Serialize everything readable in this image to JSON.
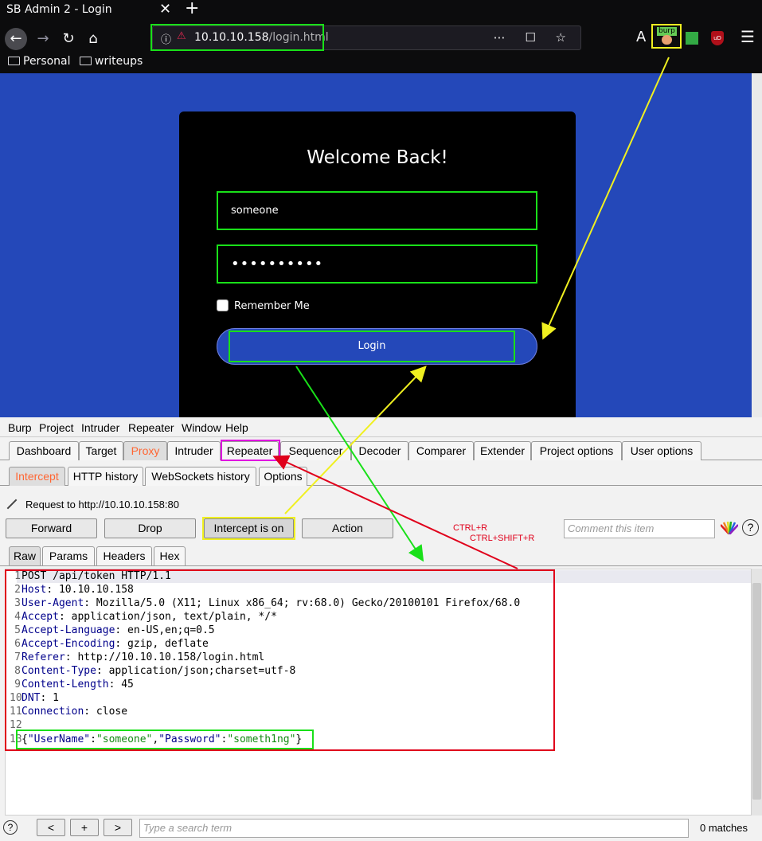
{
  "browser": {
    "tab_title": "SB Admin 2 - Login",
    "tab_close": "✕",
    "new_tab": "+",
    "url_host": "10.10.10.158",
    "url_path": "/login.html",
    "url_tools": "⋯ ☐ ☆",
    "ext_reader": "A",
    "ext_burp_badge": "burp",
    "ublock_label": "uD",
    "menu_icon": "☰",
    "bookmarks": [
      "Personal",
      "writeups"
    ],
    "icons": {
      "back": "←",
      "forward": "→",
      "reload": "↻",
      "home": "⌂",
      "info": "ⓘ",
      "lock": "⚠"
    }
  },
  "login": {
    "heading": "Welcome Back!",
    "username_value": "someone",
    "password_mask": "••••••••••",
    "remember_label": "Remember Me",
    "login_button": "Login"
  },
  "burp": {
    "menu": [
      "Burp",
      "Project",
      "Intruder",
      "Repeater",
      "Window",
      "Help"
    ],
    "tabs": [
      "Dashboard",
      "Target",
      "Proxy",
      "Intruder",
      "Repeater",
      "Sequencer",
      "Decoder",
      "Comparer",
      "Extender",
      "Project options",
      "User options"
    ],
    "active_tab": "Proxy",
    "proxy_tabs": [
      "Intercept",
      "HTTP history",
      "WebSockets history",
      "Options"
    ],
    "request_label": "Request to http://10.10.10.158:80",
    "buttons": {
      "forward": "Forward",
      "drop": "Drop",
      "intercept": "Intercept is on",
      "action": "Action"
    },
    "comment_placeholder": "Comment this item",
    "help": "?",
    "shortcut_1": "CTRL+R",
    "shortcut_2": "CTRL+SHIFT+R",
    "view_tabs": [
      "Raw",
      "Params",
      "Headers",
      "Hex"
    ],
    "request_lines": [
      {
        "n": "1",
        "key": "",
        "val": "POST /api/token HTTP/1.1"
      },
      {
        "n": "2",
        "key": "Host",
        "val": ": 10.10.10.158"
      },
      {
        "n": "3",
        "key": "User-Agent",
        "val": ": Mozilla/5.0 (X11; Linux x86_64; rv:68.0) Gecko/20100101 Firefox/68.0"
      },
      {
        "n": "4",
        "key": "Accept",
        "val": ": application/json, text/plain, */*"
      },
      {
        "n": "5",
        "key": "Accept-Language",
        "val": ": en-US,en;q=0.5"
      },
      {
        "n": "6",
        "key": "Accept-Encoding",
        "val": ": gzip, deflate"
      },
      {
        "n": "7",
        "key": "Referer",
        "val": ": http://10.10.10.158/login.html"
      },
      {
        "n": "8",
        "key": "Content-Type",
        "val": ": application/json;charset=utf-8"
      },
      {
        "n": "9",
        "key": "Content-Length",
        "val": ": 45"
      },
      {
        "n": "10",
        "key": "DNT",
        "val": ": 1"
      },
      {
        "n": "11",
        "key": "Connection",
        "val": ": close"
      },
      {
        "n": "12",
        "key": "",
        "val": ""
      },
      {
        "n": "13",
        "key": "",
        "val": ""
      }
    ],
    "body": {
      "open": "{",
      "k1": "\"UserName\"",
      "colon1": ":",
      "v1": "\"someone\"",
      "comma": ",",
      "k2": "\"Password\"",
      "colon2": ":",
      "v2": "\"someth1ng\"",
      "close": "}"
    },
    "nav_buttons": [
      "<",
      "+",
      ">"
    ],
    "search_placeholder": "Type a search term",
    "matches": "0 matches"
  },
  "annotation_colors": {
    "green": "#19e019",
    "yellow": "#f0f020",
    "red": "#e0001b",
    "magenta": "#e010e0"
  }
}
